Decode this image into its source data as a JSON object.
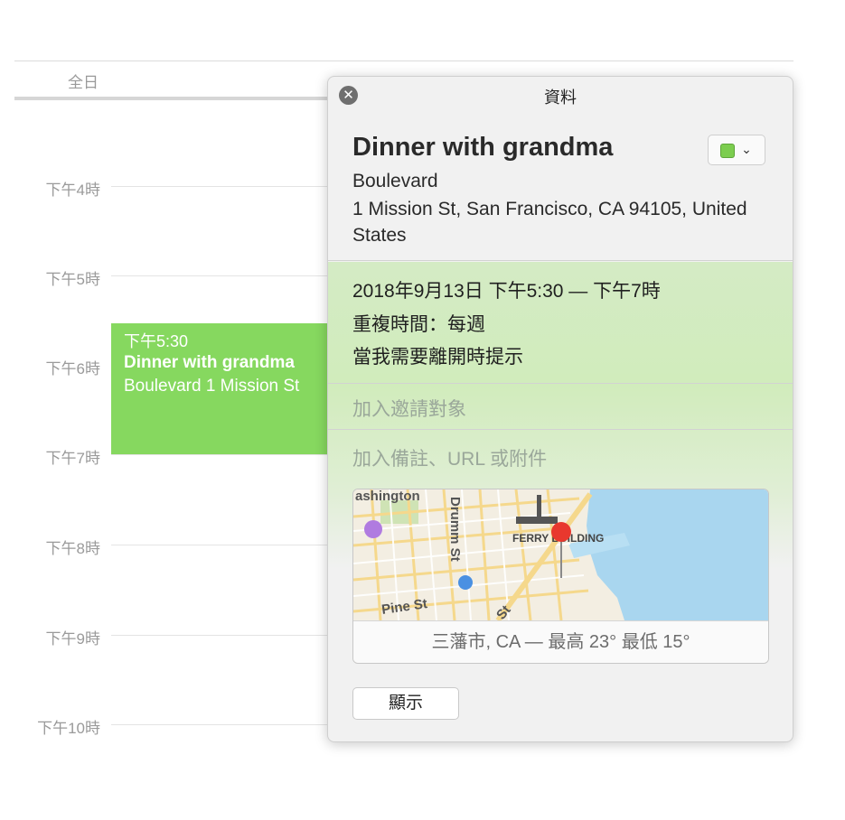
{
  "calendar": {
    "all_day_label": "全日",
    "hours": [
      "下午4時",
      "下午5時",
      "下午6時",
      "下午7時",
      "下午8時",
      "下午9時",
      "下午10時"
    ],
    "event": {
      "time": "下午5:30",
      "title": "Dinner with grandma",
      "location": "Boulevard 1 Mission St",
      "color": "#86d85f"
    }
  },
  "popover": {
    "header_title": "資料",
    "close_icon": "close-icon",
    "event_title": "Dinner with grandma",
    "calendar_color": "#7ccd4f",
    "location_name": "Boulevard",
    "location_address": "1 Mission St, San Francisco, CA  94105, United States",
    "datetime": "2018年9月13日 下午5:30 — 下午7時",
    "repeat": "重複時間：每週",
    "alert": "當我需要離開時提示",
    "add_invitees_placeholder": "加入邀請對象",
    "add_notes_placeholder": "加入備註、URL 或附件",
    "map": {
      "street_labels": [
        "ashington",
        "Drumm St",
        "Pine St",
        "St"
      ],
      "landmark": "FERRY BUILDING",
      "weather": "三藩市, CA — 最高 23° 最低 15°"
    },
    "show_button": "顯示"
  }
}
